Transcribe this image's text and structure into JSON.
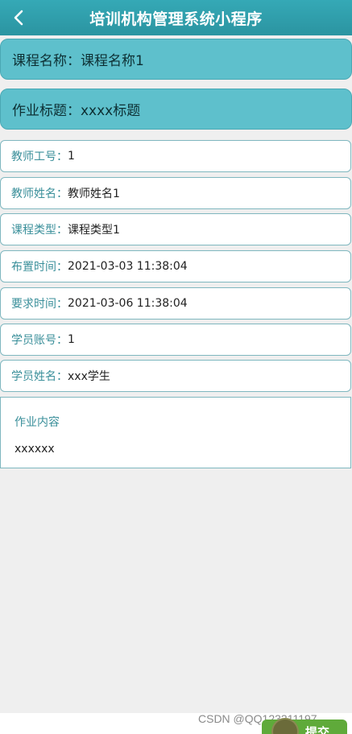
{
  "nav": {
    "title": "培训机构管理系统小程序",
    "back_icon": "chevron-left-icon"
  },
  "header_cards": [
    {
      "label": "课程名称：",
      "value": "课程名称1"
    },
    {
      "label": "作业标题：",
      "value": "xxxx标题"
    }
  ],
  "fields": [
    {
      "label": "教师工号：",
      "value": "1"
    },
    {
      "label": "教师姓名：",
      "value": "教师姓名1"
    },
    {
      "label": "课程类型：",
      "value": "课程类型1"
    },
    {
      "label": "布置时间：",
      "value": "2021-03-03 11:38:04"
    },
    {
      "label": "要求时间：",
      "value": "2021-03-06 11:38:04"
    },
    {
      "label": "学员账号：",
      "value": "1"
    },
    {
      "label": "学员姓名：",
      "value": "xxx学生"
    }
  ],
  "content": {
    "label": "作业内容",
    "value": "xxxxxx"
  },
  "footer": {
    "watermark": "CSDN @QQ123311197",
    "fab_label": "提交"
  },
  "colors": {
    "nav_bg": "#2b94a1",
    "card_bg": "#5ec0cc",
    "label_text": "#3a8f9a",
    "border": "#7fb7bf"
  }
}
